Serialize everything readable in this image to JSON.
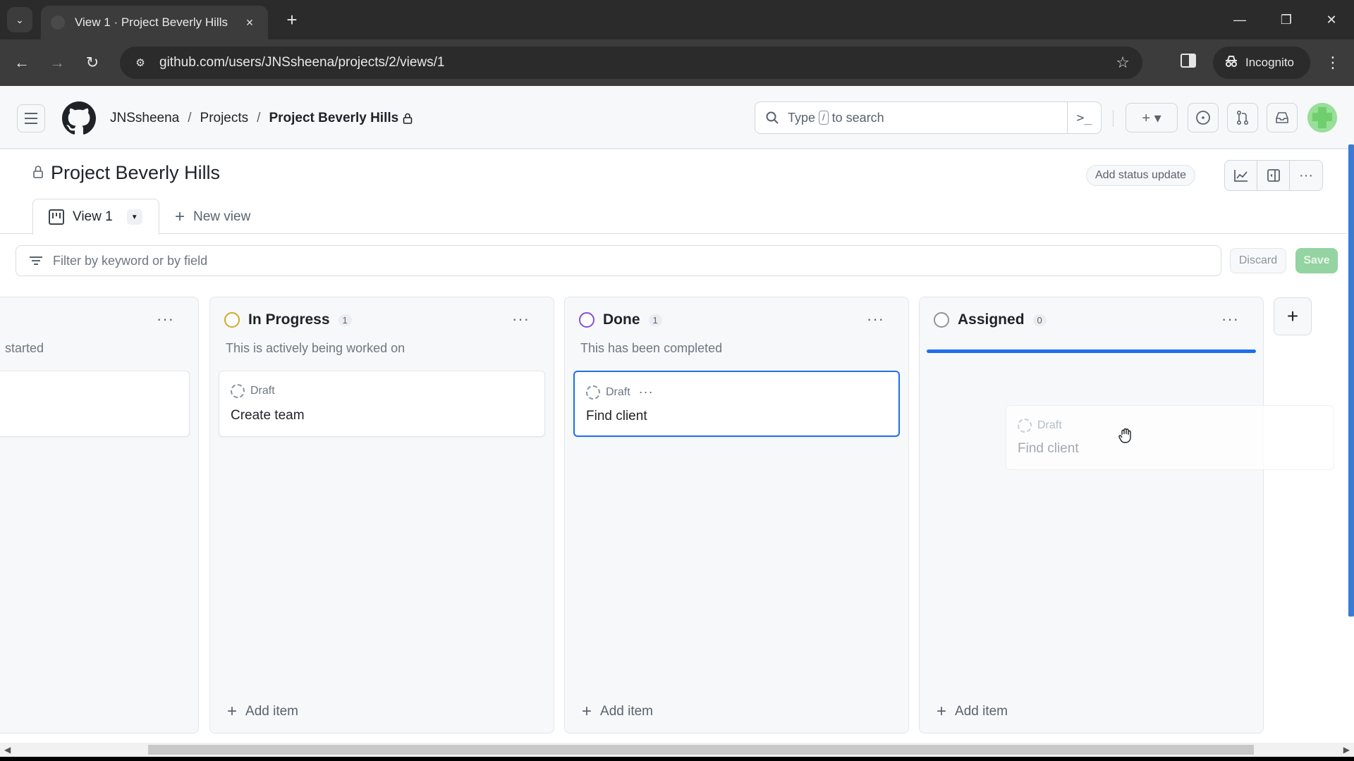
{
  "browser": {
    "tab_title": "View 1 · Project Beverly Hills",
    "url": "github.com/users/JNSsheena/projects/2/views/1",
    "incognito_label": "Incognito",
    "icons": {
      "tab_list": "chevron-down",
      "close_tab": "×",
      "new_tab": "+",
      "minimize": "—",
      "restore": "❐",
      "close_window": "✕",
      "back": "←",
      "forward": "→",
      "reload": "↻",
      "site_settings": "⚙",
      "bookmark": "☆",
      "incognito": "🕵",
      "menu": "⋮"
    }
  },
  "header": {
    "breadcrumb": [
      {
        "label": "JNSsheena"
      },
      {
        "label": "Projects"
      },
      {
        "label": "Project Beverly Hills",
        "private": true
      }
    ],
    "search": {
      "placeholder_before": "Type",
      "placeholder_key": "/",
      "placeholder_after": "to search",
      "command_palette": ">_"
    },
    "create_button": "+ ▾",
    "avatar_color": "#98df98"
  },
  "project": {
    "title": "Project Beverly Hills",
    "status_update_label": "Add status update",
    "views": [
      {
        "label": "View 1",
        "active": true
      }
    ],
    "new_view_label": "New view"
  },
  "filter": {
    "placeholder": "Filter by keyword or by field",
    "value": "",
    "discard_label": "Discard",
    "save_label": "Save"
  },
  "board": {
    "columns": [
      {
        "name": "",
        "description": "started",
        "count": null,
        "status_color": "",
        "cards": [
          {
            "title": "",
            "meta": ""
          }
        ],
        "partially_visible": true
      },
      {
        "name": "In Progress",
        "count": "1",
        "status_color": "#d4a72c",
        "description": "This is actively being worked on",
        "cards": [
          {
            "meta": "Draft",
            "title": "Create team"
          }
        ],
        "add_item_label": "Add item"
      },
      {
        "name": "Done",
        "count": "1",
        "status_color": "#8250df",
        "description": "This has been completed",
        "cards": [
          {
            "meta": "Draft",
            "title": "Find client",
            "selected": true
          }
        ],
        "add_item_label": "Add item"
      },
      {
        "name": "Assigned",
        "count": "0",
        "status_color": "#8c959f",
        "description": "",
        "cards": [],
        "add_item_label": "Add item",
        "drop_target": true
      }
    ],
    "dragging_card": {
      "meta": "Draft",
      "title": "Find client"
    },
    "menu_glyph": "···",
    "add_column_glyph": "+"
  },
  "colors": {
    "accent_blue": "#1f6feb",
    "save_green": "#94d3a2"
  }
}
